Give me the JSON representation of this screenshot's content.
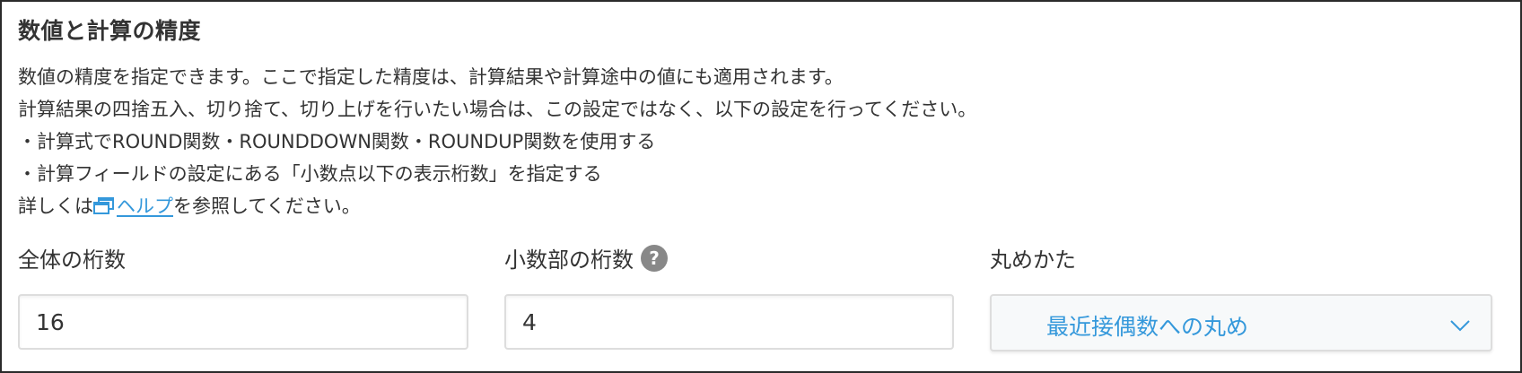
{
  "section": {
    "title": "数値と計算の精度",
    "description_lines": [
      "数値の精度を指定できます。ここで指定した精度は、計算結果や計算途中の値にも適用されます。",
      "計算結果の四捨五入、切り捨て、切り上げを行いたい場合は、この設定ではなく、以下の設定を行ってください。",
      "・計算式でROUND関数・ROUNDDOWN関数・ROUNDUP関数を使用する",
      "・計算フィールドの設定にある「小数点以下の表示桁数」を指定する"
    ],
    "help_line": {
      "prefix": "詳しくは",
      "link_text": "ヘルプ",
      "suffix": "を参照してください。",
      "link_icon": "external-window-icon"
    }
  },
  "fields": {
    "total_digits": {
      "label": "全体の桁数",
      "value": "16"
    },
    "decimal_digits": {
      "label": "小数部の桁数",
      "value": "4",
      "help_icon": "?"
    },
    "rounding": {
      "label": "丸めかた",
      "selected": "最近接偶数への丸め",
      "icon": "chevron-down-icon"
    }
  },
  "colors": {
    "text": "#333333",
    "link": "#3498db",
    "border": "#dddddd",
    "panel_border": "#2b2b2b",
    "help_icon_bg": "#888888",
    "select_bg": "#f7f9fa"
  }
}
